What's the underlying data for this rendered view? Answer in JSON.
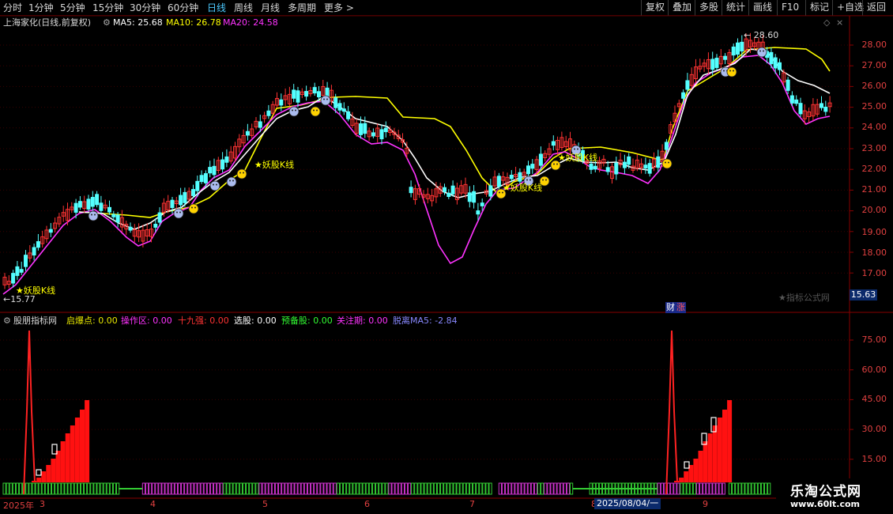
{
  "toolbar": {
    "left": [
      {
        "label": "分时",
        "active": false
      },
      {
        "label": "1分钟",
        "active": false
      },
      {
        "label": "5分钟",
        "active": false
      },
      {
        "label": "15分钟",
        "active": false
      },
      {
        "label": "30分钟",
        "active": false
      },
      {
        "label": "60分钟",
        "active": false
      },
      {
        "label": "日线",
        "active": true
      },
      {
        "label": "周线",
        "active": false
      },
      {
        "label": "月线",
        "active": false
      },
      {
        "label": "多周期",
        "active": false
      },
      {
        "label": "更多",
        "active": false
      }
    ],
    "more_arrow": ">",
    "right": [
      "复权",
      "叠加",
      "多股",
      "统计",
      "画线",
      "F10",
      "标记",
      "+自选",
      "返回"
    ]
  },
  "main_panel": {
    "stock_title": "上海家化(日线,前复权)",
    "ma5_label": "MA5: 25.68",
    "ma10_label": "MA10: 26.78",
    "ma20_label": "MA20: 24.58",
    "high_marker": "28.60",
    "low_marker": "15.77",
    "current_price_box": "15.63",
    "watermark": "★指标公式网",
    "finance_badge": "财",
    "rise_badge": "涨",
    "pattern_label": "妖股K线",
    "y_ticks": [
      "28.00",
      "27.00",
      "26.00",
      "25.00",
      "24.00",
      "23.00",
      "22.00",
      "21.00",
      "20.00",
      "19.00",
      "18.00",
      "17.00"
    ]
  },
  "indicator_panel": {
    "name": "股朋指标网",
    "items": [
      {
        "label": "启爆点: 0.00",
        "color": "#e8e800"
      },
      {
        "label": "操作区: 0.00",
        "color": "#ff33ff"
      },
      {
        "label": "十九强: 0.00",
        "color": "#ff3333"
      },
      {
        "label": "选股: 0.00",
        "color": "#ffffff"
      },
      {
        "label": "预备股: 0.00",
        "color": "#33ff33"
      },
      {
        "label": "关注期: 0.00",
        "color": "#ff33ff"
      },
      {
        "label": "脱离MA5: -2.84",
        "color": "#8888ff"
      }
    ],
    "y_ticks": [
      "75.00",
      "60.00",
      "45.00",
      "30.00",
      "15.00"
    ]
  },
  "x_axis": {
    "labels": [
      "2025年",
      "3",
      "4",
      "5",
      "6",
      "7",
      "8",
      "9"
    ],
    "cursor_date": "2025/08/04/一"
  },
  "brand": {
    "name": "乐淘公式网",
    "url": "www.60lt.com"
  },
  "colors": {
    "up": "#ff3333",
    "down": "#54ffff",
    "ma_white": "#ffffff",
    "ma_yellow": "#ffff00",
    "ma_magenta": "#ff33ff",
    "axis": "#880000"
  }
}
